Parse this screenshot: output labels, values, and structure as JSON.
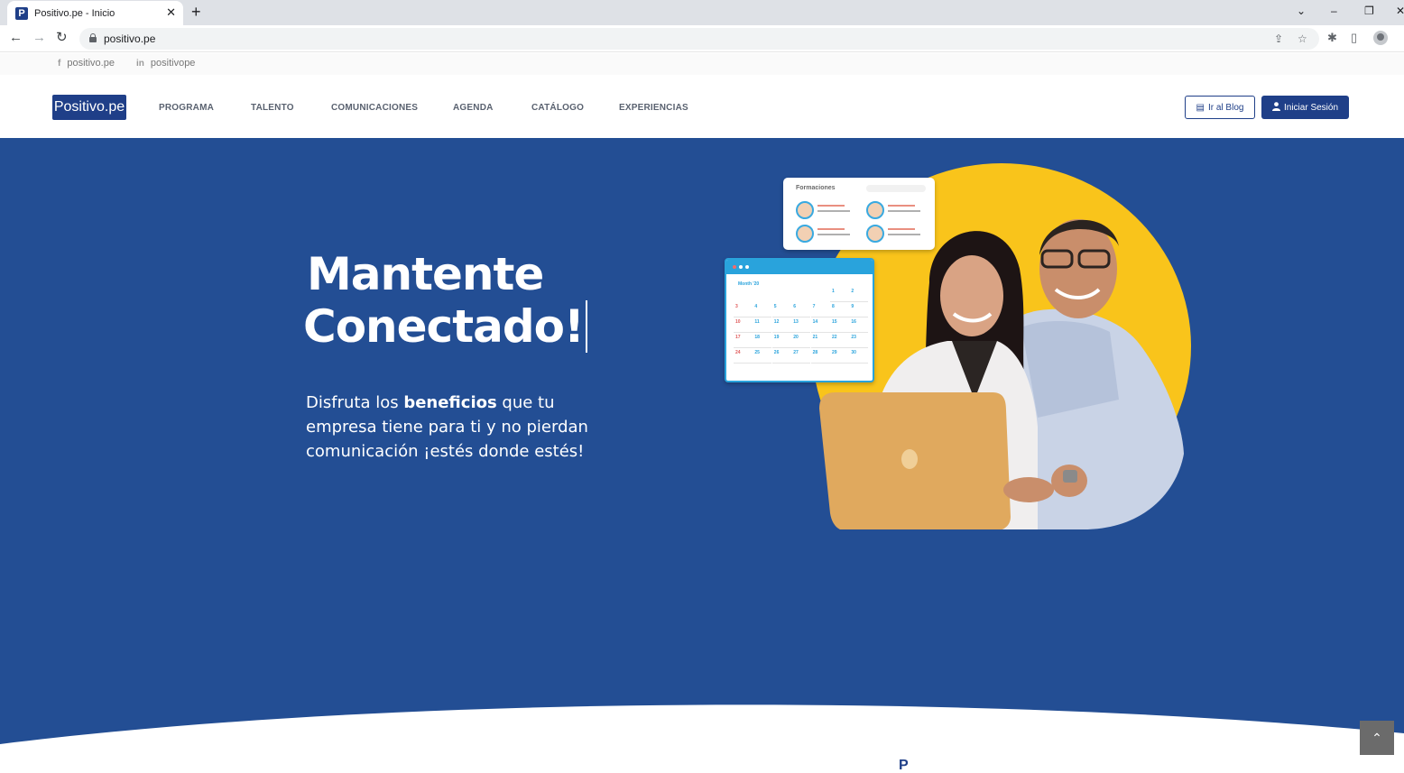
{
  "browser": {
    "tab_title": "Positivo.pe - Inicio",
    "tab_favicon": "P",
    "tab_close": "✕",
    "new_tab": "+",
    "url": "positivo.pe",
    "window_controls": {
      "tabsearch": "⌄",
      "minimize": "–",
      "restore": "❐",
      "close": "✕"
    },
    "nav": {
      "back": "←",
      "forward": "→",
      "reload": "↻"
    },
    "icons": {
      "share": "⇪",
      "bookmark": "☆",
      "extensions": "✱",
      "sidepanel": "▯"
    }
  },
  "social": {
    "facebook": {
      "icon": "f",
      "label": "positivo.pe"
    },
    "linkedin": {
      "icon": "in",
      "label": "positivope"
    }
  },
  "header": {
    "logo": "Positivo.pe",
    "nav": [
      "PROGRAMA",
      "TALENTO",
      "COMUNICACIONES",
      "AGENDA",
      "CATÁLOGO",
      "EXPERIENCIAS"
    ],
    "blog_button": "Ir al Blog",
    "blog_icon": "▤",
    "login_button": "Iniciar Sesión",
    "login_icon": "👤"
  },
  "hero": {
    "title_line1": "Mantente",
    "title_line2": "Conectado!",
    "text_before": "Disfruta los ",
    "text_bold": "beneficios",
    "text_after": " que tu empresa tiene para ti y no pierdan comunicación ¡estés donde estés!",
    "card_formaciones_title": "Formaciones",
    "calendar_month": "Month '20",
    "calendar_days": [
      "1",
      "2",
      "3",
      "4",
      "5",
      "6",
      "7",
      "8",
      "9",
      "10",
      "11",
      "12",
      "13",
      "14",
      "15",
      "16",
      "17",
      "18",
      "19",
      "20",
      "21",
      "22",
      "23",
      "24",
      "25",
      "26",
      "27",
      "28",
      "29",
      "30"
    ]
  },
  "colors": {
    "brand": "#1f3f88",
    "hero_bg": "#234e94",
    "accent_yellow": "#f9c41b",
    "calendar_blue": "#29a3dc"
  },
  "scroll_top": "⌃",
  "peek_letter": "P"
}
